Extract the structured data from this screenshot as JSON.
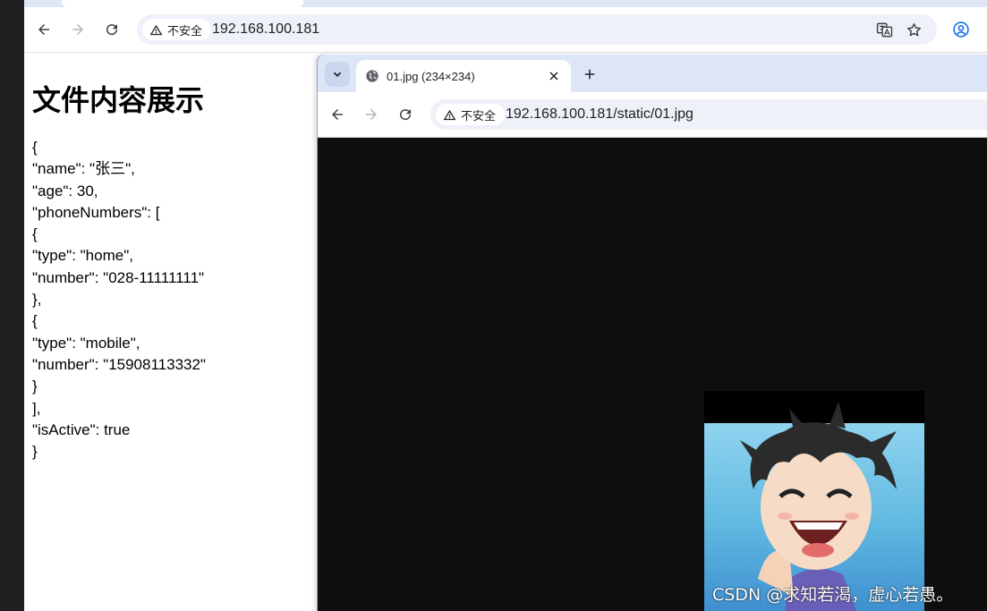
{
  "browser": {
    "address": {
      "security_label": "不安全",
      "url": "192.168.100.181"
    }
  },
  "page": {
    "heading": "文件内容展示",
    "json_lines": [
      "{",
      "\"name\": \"张三\",",
      "\"age\": 30,",
      "\"phoneNumbers\": [",
      "{",
      "\"type\": \"home\",",
      "\"number\": \"028-11111111\"",
      "},",
      "{",
      "\"type\": \"mobile\",",
      "\"number\": \"15908113332\"",
      "}",
      "],",
      "\"isActive\": true",
      "}"
    ]
  },
  "popup": {
    "tab_title": "01.jpg (234×234)",
    "address": {
      "security_label": "不安全",
      "url": "192.168.100.181/static/01.jpg"
    }
  },
  "watermark": "CSDN @求知若渴，虚心若愚。"
}
